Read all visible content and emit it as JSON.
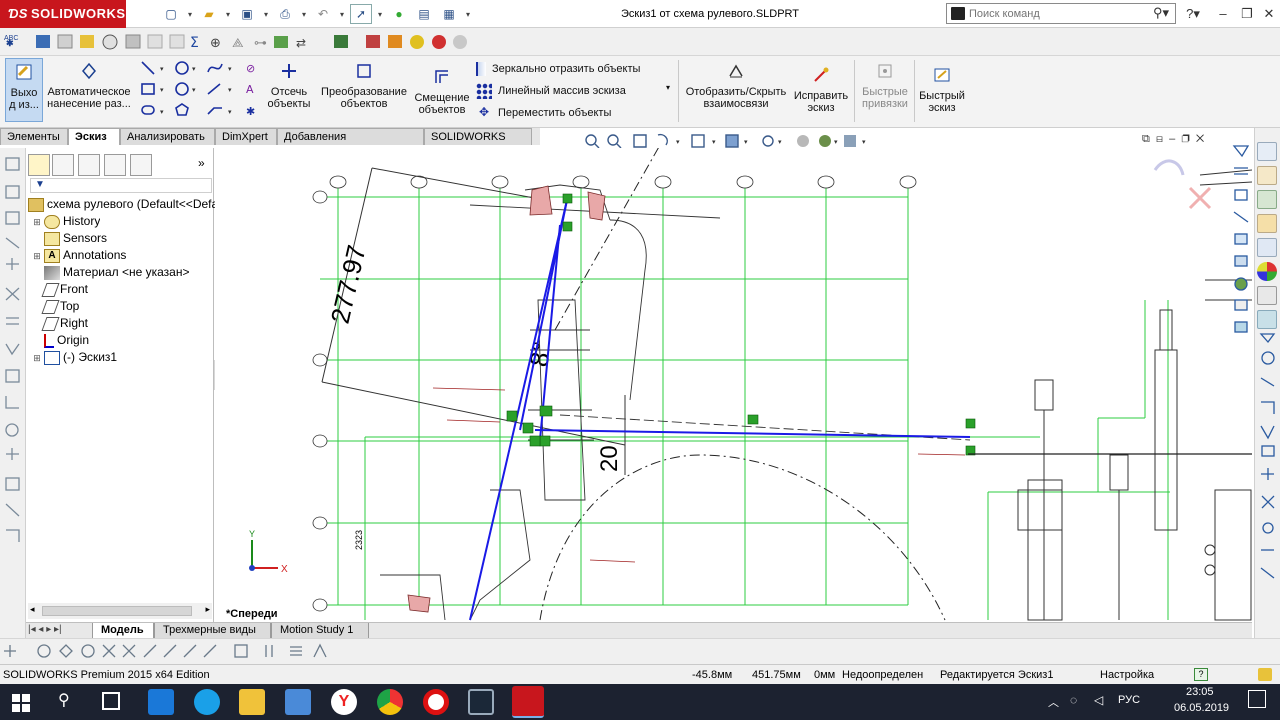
{
  "app": {
    "brand": "SOLIDWORKS",
    "document_title": "Эскиз1 от схема рулевого.SLDPRT",
    "search_placeholder": "Поиск команд"
  },
  "ribbon": {
    "exit_sketch": "Выхо\nд из...",
    "auto_dimension": "Автоматическое\nнанесение раз...",
    "trim": "Отсечь\nобъекты",
    "convert": "Преобразование\nобъектов",
    "offset": "Смещение\nобъектов",
    "mirror": "Зеркально отразить объекты",
    "linear_pattern": "Линейный массив эскиза",
    "move": "Переместить объекты",
    "show_relations": "Отобразить/Скрыть\nвзаимосвязи",
    "repair": "Исправить\nэскиз",
    "quick_snaps": "Быстрые\nпривязки",
    "rapid_sketch": "Быстрый\nэскиз"
  },
  "tabs": [
    "Элементы",
    "Эскиз",
    "Анализировать",
    "DimXpert",
    "Добавления SOLIDWORKS",
    "SOLIDWORKS MBD"
  ],
  "active_tab": "Эскиз",
  "tree": {
    "root": "схема рулевого  (Default<<Default",
    "items": [
      "History",
      "Sensors",
      "Annotations",
      "Материал <не указан>",
      "Front",
      "Top",
      "Right",
      "Origin",
      "(-) Эскиз1"
    ]
  },
  "graphics": {
    "dimension_1": "277.97",
    "dimension_angle": "8°",
    "dimension_2": "20",
    "side_label": "2323",
    "view_label": "*Спереди",
    "axis_x": "X",
    "axis_y": "Y"
  },
  "bottom_tabs": [
    "Модель",
    "Трехмерные виды",
    "Motion Study 1"
  ],
  "status": {
    "edition": "SOLIDWORKS Premium 2015 x64 Edition",
    "x": "-45.8мм",
    "y": "451.75мм",
    "z": "0мм",
    "state": "Недоопределен",
    "editing": "Редактируется Эскиз1",
    "settings": "Настройка"
  },
  "taskbar": {
    "lang": "РУС",
    "time": "23:05",
    "date": "06.05.2019"
  },
  "colors": {
    "grid": "#2ecc40",
    "sketch_blue": "#1a1ae6",
    "brand_red": "#c8161d",
    "taskbar": "#1c2230"
  }
}
